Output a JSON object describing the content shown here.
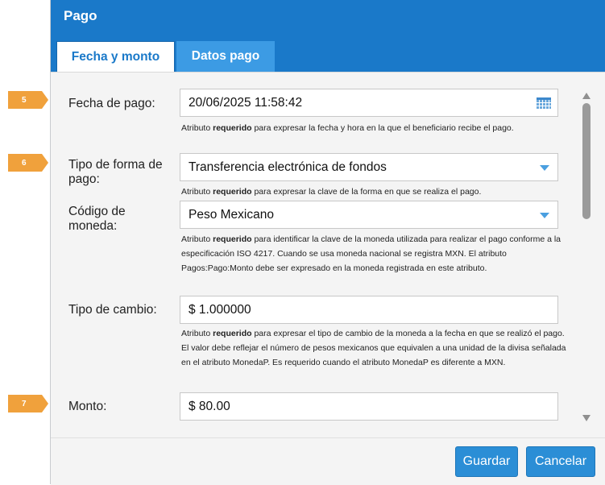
{
  "dialog": {
    "title": "Pago"
  },
  "tabs": [
    {
      "label": "Fecha y monto",
      "active": true
    },
    {
      "label": "Datos pago",
      "active": false
    }
  ],
  "steps": [
    "5",
    "6",
    "7"
  ],
  "fields": {
    "fecha": {
      "label": "Fecha de pago:",
      "value": "20/06/2025 11:58:42",
      "help_strong": "requerido",
      "help_pre": "Atributo ",
      "help_post": " para expresar la fecha y hora en la que el beneficiario recibe el pago."
    },
    "forma": {
      "label": "Tipo de forma de pago:",
      "value": "Transferencia electrónica de fondos",
      "help_pre": "Atributo ",
      "help_strong": "requerido",
      "help_post": " para expresar la clave de la forma en que se realiza el pago."
    },
    "moneda": {
      "label": "Código de moneda:",
      "value": "Peso Mexicano",
      "help_pre": "Atributo ",
      "help_strong": "requerido",
      "help_post": " para identificar la clave de la moneda utilizada para realizar el pago conforme a la especificación ISO 4217. Cuando se usa moneda nacional se registra MXN. El atributo Pagos:Pago:Monto debe ser expresado en la moneda registrada en este atributo."
    },
    "cambio": {
      "label": "Tipo de cambio:",
      "value": "$ 1.000000",
      "help_pre": "Atributo ",
      "help_strong": "requerido",
      "help_post": " para expresar el tipo de cambio de la moneda a la fecha en que se realizó el pago. El valor debe reflejar el número de pesos mexicanos que equivalen a una unidad de la divisa señalada en el atributo MonedaP. Es requerido cuando el atributo MonedaP es diferente a MXN."
    },
    "monto": {
      "label": "Monto:",
      "value": "$ 80.00"
    }
  },
  "buttons": {
    "save": "Guardar",
    "cancel": "Cancelar"
  },
  "colors": {
    "primary": "#1a79c9",
    "step_marker": "#f0a13c",
    "button": "#2b8ed6"
  },
  "icons": {
    "fecha": "calendar-icon",
    "dropdown": "chevron-down-icon"
  }
}
